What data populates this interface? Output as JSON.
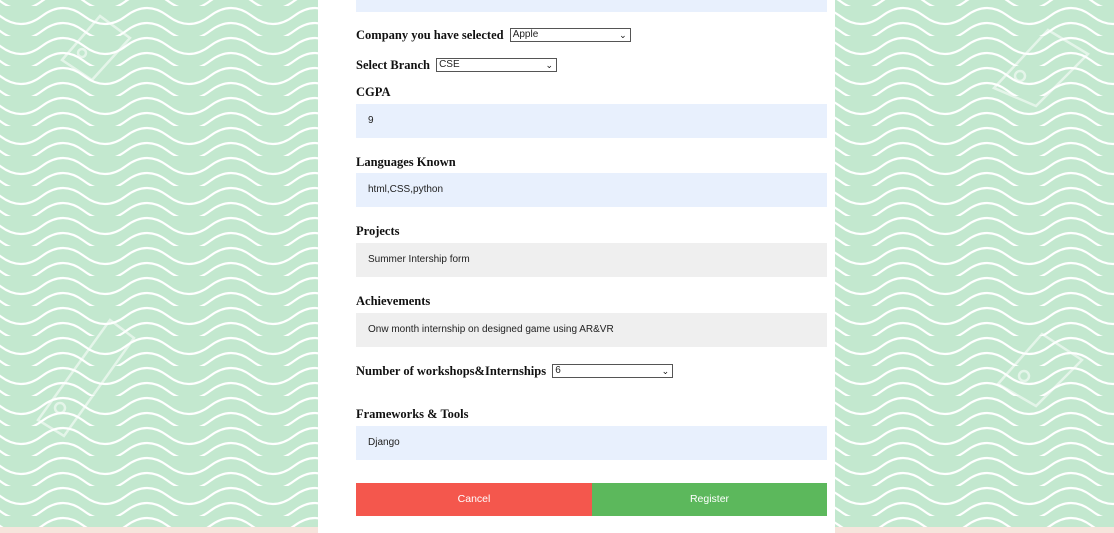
{
  "company": {
    "label": "Company you have selected",
    "value": "Apple"
  },
  "branch": {
    "label": "Select Branch",
    "value": "CSE"
  },
  "cgpa": {
    "label": "CGPA",
    "value": "9"
  },
  "languages": {
    "label": "Languages Known",
    "value": "html,CSS,python"
  },
  "projects": {
    "label": "Projects",
    "value": "Summer Intership  form"
  },
  "achievements": {
    "label": "Achievements",
    "value": "Onw month internship on designed game using AR&VR"
  },
  "workshops": {
    "label": "Number of workshops&Internships",
    "value": "6"
  },
  "frameworks": {
    "label": "Frameworks & Tools",
    "value": "Django"
  },
  "buttons": {
    "cancel": "Cancel",
    "register": "Register"
  },
  "colors": {
    "background": "#c3e8cf",
    "wave_line": "#ffffff",
    "field_blue": "#e8f0fd",
    "field_gray": "#efefef",
    "cancel": "#f4574d",
    "register": "#5cb85c"
  },
  "watermark_icon": "123rf-watermark-icon"
}
